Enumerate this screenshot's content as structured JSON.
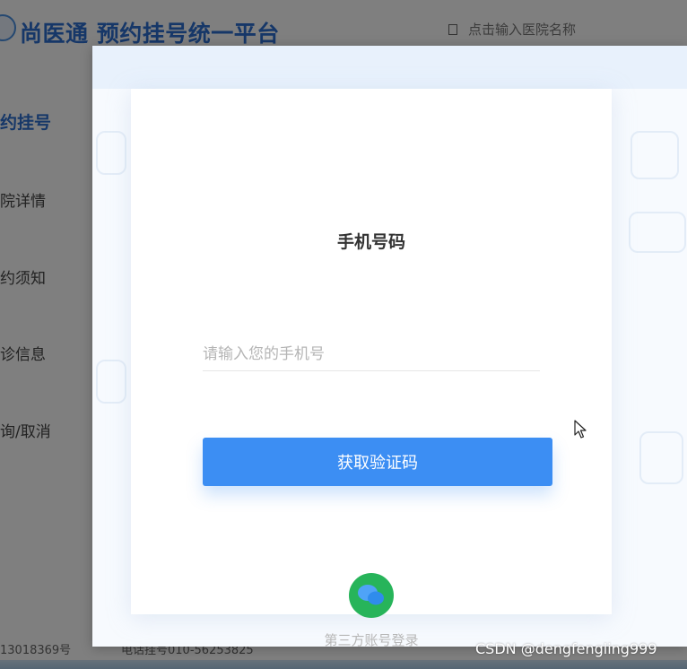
{
  "background": {
    "site_title": "尚医通 预约挂号统一平台",
    "search_placeholder": "点击输入医院名称",
    "nav_items": [
      {
        "label": "约挂号"
      },
      {
        "label": "院详情"
      },
      {
        "label": "约须知"
      },
      {
        "label": "诊信息"
      },
      {
        "label": "询/取消"
      }
    ],
    "footer_left": "13018369号",
    "footer_phone": "电话挂号010-56253825"
  },
  "dialog": {
    "title": "手机号码",
    "phone_input": {
      "placeholder": "请输入您的手机号",
      "value": ""
    },
    "get_code_label": "获取验证码",
    "third_party_label": "第三方账号登录"
  },
  "watermark": "CSDN @dengfengling999",
  "colors": {
    "accent": "#3c8ef3",
    "brand": "#2c6fd1",
    "wechat": "#27b45a"
  }
}
